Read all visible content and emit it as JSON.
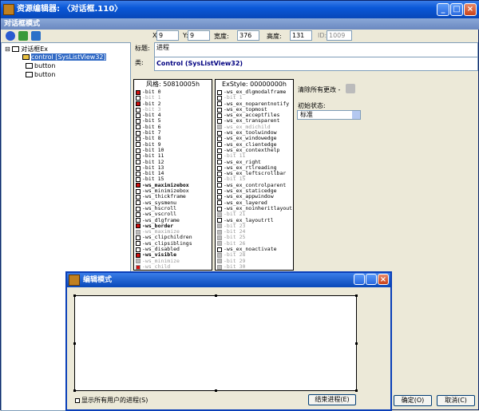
{
  "window": {
    "title": "资源编辑器: 〈对话框.110〉",
    "subtitle": "对话框模式"
  },
  "tree": {
    "root": "对话框Ex",
    "items": [
      "control [SysListView32]",
      "button",
      "button"
    ]
  },
  "props": {
    "x_label": "X:",
    "x": "9",
    "y_label": "Y:",
    "y": "9",
    "w_label": "宽度:",
    "w": "376",
    "h_label": "高度:",
    "h": "131",
    "id_label": "ID:",
    "id": "1009",
    "title_label": "标题:",
    "title": "进程",
    "class_label": "类:",
    "class_value": "Control  (SysListView32)"
  },
  "style": {
    "header": "风格: 50810005h",
    "rows": [
      {
        "t": "-bit 0",
        "s": "chk"
      },
      {
        "t": "-bit 1",
        "s": "dis"
      },
      {
        "t": "-bit 2",
        "s": "chk"
      },
      {
        "t": "-bit 3",
        "s": "dis"
      },
      {
        "t": "-bit 4",
        "s": ""
      },
      {
        "t": "-bit 5",
        "s": ""
      },
      {
        "t": "-bit 6",
        "s": ""
      },
      {
        "t": "-bit 7",
        "s": ""
      },
      {
        "t": "-bit 8",
        "s": ""
      },
      {
        "t": "-bit 9",
        "s": ""
      },
      {
        "t": "-bit 10",
        "s": ""
      },
      {
        "t": "-bit 11",
        "s": ""
      },
      {
        "t": "-bit 12",
        "s": ""
      },
      {
        "t": "-bit 13",
        "s": ""
      },
      {
        "t": "-bit 14",
        "s": ""
      },
      {
        "t": "-bit 15",
        "s": ""
      },
      {
        "t": "-ws_maximizebox",
        "s": "chkb"
      },
      {
        "t": "-ws_minimizebox",
        "s": ""
      },
      {
        "t": "-ws_thickframe",
        "s": ""
      },
      {
        "t": "-ws_sysmenu",
        "s": ""
      },
      {
        "t": "-ws_hscroll",
        "s": ""
      },
      {
        "t": "-ws_vscroll",
        "s": ""
      },
      {
        "t": "-ws_dlgframe",
        "s": ""
      },
      {
        "t": "-ws_border",
        "s": "chkb"
      },
      {
        "t": "-ws_maximize",
        "s": "gray"
      },
      {
        "t": "-ws_clipchildren",
        "s": ""
      },
      {
        "t": "-ws_clipsiblings",
        "s": ""
      },
      {
        "t": "-ws_disabled",
        "s": ""
      },
      {
        "t": "-ws_visible",
        "s": "chkb"
      },
      {
        "t": "-ws_minimize",
        "s": "gray"
      },
      {
        "t": "-ws_child",
        "s": "graychk"
      },
      {
        "t": "-ws_popup",
        "s": "gray"
      }
    ]
  },
  "exstyle": {
    "header": "ExStyle: 00000000h",
    "rows": [
      {
        "t": "-ws_ex_dlgmodalframe",
        "s": ""
      },
      {
        "t": "-bit 1",
        "s": "dis"
      },
      {
        "t": "-ws_ex_noparentnotify",
        "s": ""
      },
      {
        "t": "-ws_ex_topmost",
        "s": ""
      },
      {
        "t": "-ws_ex_acceptfiles",
        "s": ""
      },
      {
        "t": "-ws_ex_transparent",
        "s": ""
      },
      {
        "t": "-ws_ex_mdichild",
        "s": "gray"
      },
      {
        "t": "-ws_ex_toolwindow",
        "s": ""
      },
      {
        "t": "-ws_ex_windowedge",
        "s": ""
      },
      {
        "t": "-ws_ex_clientedge",
        "s": ""
      },
      {
        "t": "-ws_ex_contexthelp",
        "s": ""
      },
      {
        "t": "-bit 11",
        "s": "dis"
      },
      {
        "t": "-ws_ex_right",
        "s": ""
      },
      {
        "t": "-ws_ex_rtlreading",
        "s": ""
      },
      {
        "t": "-ws_ex_leftscrollbar",
        "s": ""
      },
      {
        "t": "-bit 15",
        "s": "dis"
      },
      {
        "t": "-ws_ex_controlparent",
        "s": ""
      },
      {
        "t": "-ws_ex_staticedge",
        "s": ""
      },
      {
        "t": "-ws_ex_appwindow",
        "s": ""
      },
      {
        "t": "-ws_ex_layered",
        "s": ""
      },
      {
        "t": "-ws_ex_noinheritlayout",
        "s": ""
      },
      {
        "t": "-bit 21",
        "s": "gray"
      },
      {
        "t": "-ws_ex_layoutrtl",
        "s": ""
      },
      {
        "t": "-bit 23",
        "s": "gray"
      },
      {
        "t": "-bit 24",
        "s": "gray"
      },
      {
        "t": "-bit 25",
        "s": "gray"
      },
      {
        "t": "-bit 26",
        "s": "gray"
      },
      {
        "t": "-ws_ex_noactivate",
        "s": ""
      },
      {
        "t": "-bit 28",
        "s": "gray"
      },
      {
        "t": "-bit 29",
        "s": "gray"
      },
      {
        "t": "-bit 30",
        "s": "gray"
      },
      {
        "t": "-bit 31",
        "s": "gray"
      }
    ]
  },
  "clear_changes": "清除所有更改 -",
  "init_state_label": "初始状态:",
  "init_state_value": "标准",
  "dialog": {
    "title": "编辑模式",
    "checkbox_label": "显示所有用户的进程(S)",
    "end_button": "结束进程(E)",
    "ok_button": "确定(O)",
    "cancel_button": "取消(C)"
  }
}
